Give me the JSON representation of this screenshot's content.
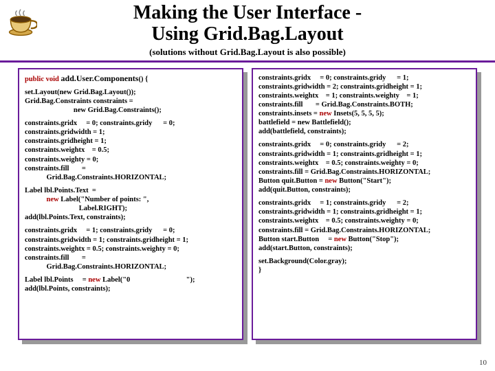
{
  "header": {
    "title_line1": "Making the User Interface -",
    "title_line2": "Using Grid.Bag.Layout",
    "subtitle": "(solutions without Grid.Bag.Layout is also possible)"
  },
  "left": {
    "p1_a": "public void ",
    "p1_b": "add.User.Components",
    "p1_c": "() {",
    "p2": "set.Layout(new Grid.Bag.Layout());\nGrid.Bag.Constraints constraints =\n                           new Grid.Bag.Constraints();",
    "p3": "constraints.gridx     = 0; constraints.gridy      = 0;\nconstraints.gridwidth = 1;\nconstraints.gridheight = 1;\nconstraints.weightx    = 0.5;\nconstraints.weighty = 0;\nconstraints.fill       =\n            Grid.Bag.Constraints.HORIZONTAL;",
    "p4_a": "Label lbl.Points.Text  =\n            ",
    "p4_kw": "new",
    "p4_b": " Label(\"Number of points: \",\n                              Label.RIGHT);\nadd(lbl.Points.Text, constraints);",
    "p5": "constraints.gridx     = 1; constraints.gridy      = 0;\nconstraints.gridwidth = 1; constraints.gridheight = 1;\nconstraints.weightx = 0.5; constraints.weighty = 0;\nconstraints.fill       =\n            Grid.Bag.Constraints.HORIZONTAL;",
    "p6_a": "Label lbl.Points     = ",
    "p6_kw": "new",
    "p6_b": " Label(\"0                               \");\nadd(lbl.Points, constraints);"
  },
  "right": {
    "p1_a": "constraints.gridx     = 0; constraints.gridy      = 1;\nconstraints.gridwidth = 2; constraints.gridheight = 1;\nconstraints.weightx    = 1; constraints.weighty    = 1;\nconstraints.fill       = Grid.Bag.Constraints.BOTH;\nconstraints.insets = ",
    "p1_kw": "new",
    "p1_b": " Insets(5, 5, 5, 5);\nbattlefield = new Battlefield();\nadd(battlefield, constraints);",
    "p2_a": "constraints.gridx     = 0; constraints.gridy      = 2;\nconstraints.gridwidth = 1; constraints.gridheight = 1;\nconstraints.weightx    = 0.5; constraints.weighty = 0;\nconstraints.fill = Grid.Bag.Constraints.HORIZONTAL;\nButton quit.Button = ",
    "p2_kw": "new",
    "p2_b": " Button(\"Start\");\nadd(quit.Button, constraints);",
    "p3_a": "constraints.gridx     = 1; constraints.gridy      = 2;\nconstraints.gridwidth = 1; constraints.gridheight = 1;\nconstraints.weightx    = 0.5; constraints.weighty = 0;\nconstraints.fill = Grid.Bag.Constraints.HORIZONTAL;\nButton start.Button     = ",
    "p3_kw": "new",
    "p3_b": " Button(\"Stop\");\nadd(start.Button, constraints);",
    "p4": "set.Background(Color.gray);\n}"
  },
  "pagenum": "10"
}
